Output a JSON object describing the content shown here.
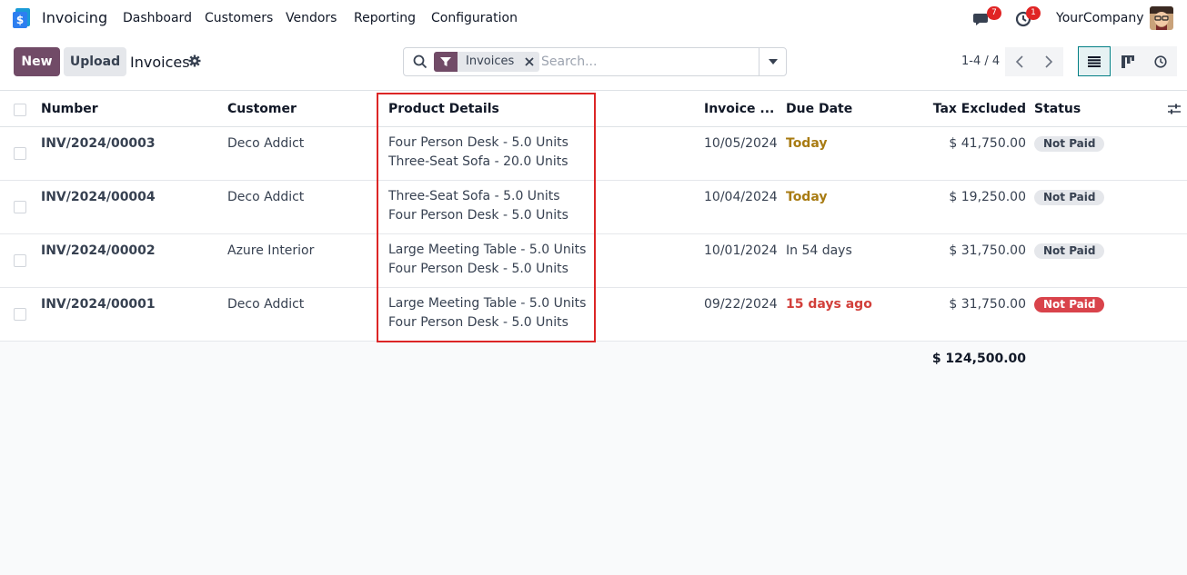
{
  "app": {
    "name": "Invoicing",
    "menu": [
      "Dashboard",
      "Customers",
      "Vendors",
      "Reporting",
      "Configuration"
    ],
    "messages_count": "7",
    "activities_count": "1",
    "company": "YourCompany"
  },
  "control_panel": {
    "new_label": "New",
    "upload_label": "Upload",
    "breadcrumb": "Invoices",
    "search": {
      "facet_label": "Invoices",
      "placeholder": "Search..."
    },
    "pager": "1-4 / 4"
  },
  "table": {
    "columns": {
      "number": "Number",
      "customer": "Customer",
      "product_details": "Product Details",
      "invoice_date": "Invoice ...",
      "due_date": "Due Date",
      "tax_excluded": "Tax Excluded",
      "status": "Status"
    },
    "rows": [
      {
        "number": "INV/2024/00003",
        "customer": "Deco Addict",
        "product_line1": "Four Person Desk - 5.0 Units",
        "product_line2": "Three-Seat Sofa - 20.0 Units",
        "invoice_date": "10/05/2024",
        "due_date": "Today",
        "tax_excluded": "$ 41,750.00",
        "status": "Not Paid"
      },
      {
        "number": "INV/2024/00004",
        "customer": "Deco Addict",
        "product_line1": "Three-Seat Sofa - 5.0 Units",
        "product_line2": "Four Person Desk - 5.0 Units",
        "invoice_date": "10/04/2024",
        "due_date": "Today",
        "tax_excluded": "$ 19,250.00",
        "status": "Not Paid"
      },
      {
        "number": "INV/2024/00002",
        "customer": "Azure Interior",
        "product_line1": "Large Meeting Table - 5.0 Units",
        "product_line2": "Four Person Desk - 5.0 Units",
        "invoice_date": "10/01/2024",
        "due_date": "In 54 days",
        "tax_excluded": "$ 31,750.00",
        "status": "Not Paid"
      },
      {
        "number": "INV/2024/00001",
        "customer": "Deco Addict",
        "product_line1": "Large Meeting Table - 5.0 Units",
        "product_line2": "Four Person Desk - 5.0 Units",
        "invoice_date": "09/22/2024",
        "due_date": "15 days ago",
        "tax_excluded": "$ 31,750.00",
        "status": "Not Paid"
      }
    ],
    "total": "$ 124,500.00"
  },
  "colors": {
    "brand": "#714b67",
    "due_today": "#a87b12",
    "overdue": "#d23f3a",
    "highlight": "#dc2626"
  }
}
